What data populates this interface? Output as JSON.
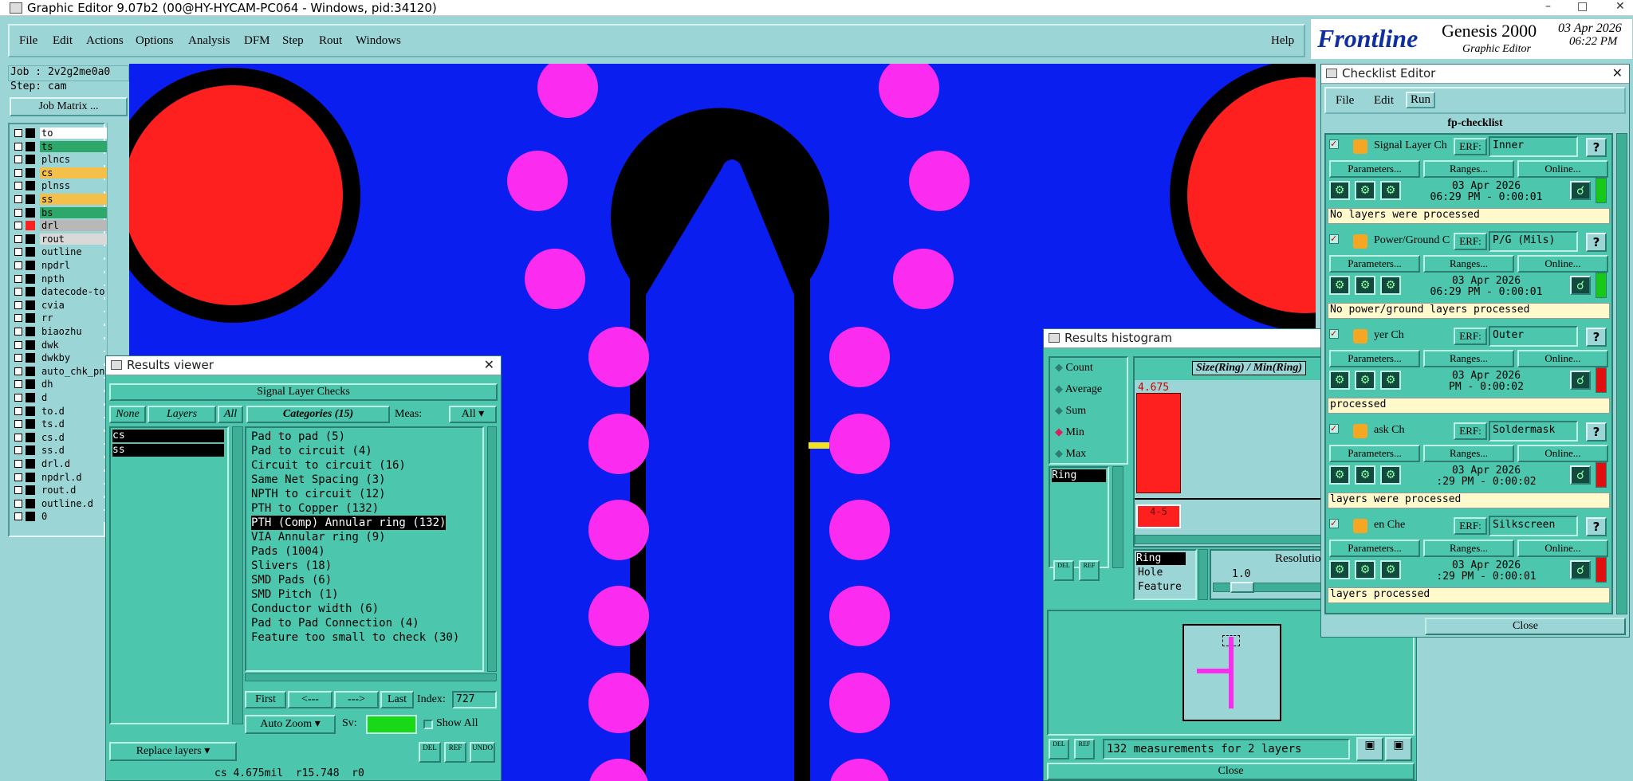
{
  "window": {
    "title": "Graphic Editor 9.07b2 (00@HY-HYCAM-PC064 - Windows, pid:34120)"
  },
  "menu": {
    "items": [
      "File",
      "Edit",
      "Actions",
      "Options",
      "Analysis",
      "DFM",
      "Step",
      "Rout",
      "Windows"
    ],
    "help": "Help"
  },
  "logo": {
    "brand": "Frontline",
    "product": "Genesis 2000",
    "module": "Graphic Editor",
    "date": "03 Apr 2026",
    "time": "06:22 PM"
  },
  "job": {
    "job_label": "Job : 2v2g2me0a0",
    "step_label": "Step: cam",
    "matrix_button": "Job Matrix ..."
  },
  "layers": [
    {
      "name": "to",
      "color": "#ffffff"
    },
    {
      "name": "ts",
      "color": "#2ea86a"
    },
    {
      "name": "plncs",
      "color": "#9bd5d6"
    },
    {
      "name": "cs",
      "color": "#f5c04a"
    },
    {
      "name": "plnss",
      "color": "#9bd5d6"
    },
    {
      "name": "ss",
      "color": "#f5c04a"
    },
    {
      "name": "bs",
      "color": "#2ea86a"
    },
    {
      "name": "drl",
      "color": "#b8b8b8"
    },
    {
      "name": "rout",
      "color": "#d9d9d9"
    },
    {
      "name": "outline",
      "color": "#9bd5d6"
    },
    {
      "name": "npdrl",
      "color": "#9bd5d6"
    },
    {
      "name": "npth",
      "color": "#9bd5d6"
    },
    {
      "name": "datecode-to",
      "color": "#9bd5d6"
    },
    {
      "name": "cvia",
      "color": "#9bd5d6"
    },
    {
      "name": "rr",
      "color": "#9bd5d6"
    },
    {
      "name": "biaozhu",
      "color": "#9bd5d6"
    },
    {
      "name": "dwk",
      "color": "#9bd5d6"
    },
    {
      "name": "dwkby",
      "color": "#9bd5d6"
    },
    {
      "name": "auto_chk_pn",
      "color": "#9bd5d6"
    },
    {
      "name": "dh",
      "color": "#9bd5d6"
    },
    {
      "name": "d",
      "color": "#9bd5d6"
    },
    {
      "name": "to.d",
      "color": "#9bd5d6"
    },
    {
      "name": "ts.d",
      "color": "#9bd5d6"
    },
    {
      "name": "cs.d",
      "color": "#9bd5d6"
    },
    {
      "name": "ss.d",
      "color": "#9bd5d6"
    },
    {
      "name": "drl.d",
      "color": "#9bd5d6"
    },
    {
      "name": "npdrl.d",
      "color": "#9bd5d6"
    },
    {
      "name": "rout.d",
      "color": "#9bd5d6"
    },
    {
      "name": "outline.d",
      "color": "#9bd5d6"
    },
    {
      "name": "0",
      "color": "#9bd5d6"
    }
  ],
  "results_viewer": {
    "title": "Results viewer",
    "header": "Signal Layer Checks",
    "none_btn": "None",
    "layers_btn": "Layers",
    "all_btn": "All",
    "layer_items": [
      "cs",
      "ss"
    ],
    "categories_label": "Categories (15)",
    "meas_label": "Meas:",
    "meas_value": "All",
    "categories": [
      "Pad to pad (5)",
      "Pad to circuit (4)",
      "Circuit to circuit (16)",
      "Same Net Spacing (3)",
      "NPTH to circuit (12)",
      "PTH to Copper (132)",
      "PTH (Comp) Annular ring (132)",
      "VIA Annular ring (9)",
      "Pads (1004)",
      "Slivers (18)",
      "SMD Pads (6)",
      "SMD Pitch (1)",
      "Conductor width (6)",
      "Pad to Pad Connection (4)",
      "Feature too small to check (30)"
    ],
    "first_btn": "First",
    "prev_btn": "<---",
    "next_btn": "--->",
    "last_btn": "Last",
    "index_label": "Index:",
    "index_value": "727",
    "autozoom": "Auto Zoom",
    "sv_label": "Sv:",
    "show_all": "Show All",
    "replace_layers": "Replace layers",
    "del": "DEL",
    "ref": "REF",
    "undo": "UNDO",
    "status": "cs 4.675mil  r15.748  r0"
  },
  "histogram": {
    "title": "Results histogram",
    "radios": [
      "Count",
      "Average",
      "Sum",
      "Min",
      "Max"
    ],
    "selected_radio": "Min",
    "list_item": "Ring",
    "chart_title": "Size(Ring) / Min(Ring)",
    "bar_value": "4.675",
    "bar_label": "4-5",
    "types": [
      "Ring",
      "Hole",
      "Feature"
    ],
    "resolution_label": "Resolution",
    "resolution_value": "1.0",
    "del": "DEL",
    "ref": "REF",
    "measurements": "132 measurements for 2 layers",
    "close": "Close"
  },
  "checklist": {
    "title": "Checklist Editor",
    "menu": [
      "File",
      "Edit",
      "Run"
    ],
    "name": "fp-checklist",
    "erf_label": "ERF:",
    "params": "Parameters...",
    "ranges": "Ranges...",
    "online": "Online...",
    "close": "Close",
    "actions": [
      {
        "label": "Signal Layer Ch",
        "erf": "Inner",
        "date": "03 Apr 2026",
        "time": "06:29 PM - 0:00:01",
        "message": "No layers were processed",
        "status": "#18c818"
      },
      {
        "label": "Power/Ground C",
        "erf": "P/G (Mils)",
        "date": "03 Apr 2026",
        "time": "06:29 PM - 0:00:01",
        "message": "No power/ground layers processed",
        "status": "#18c818"
      },
      {
        "label": "yer Ch",
        "erf": "Outer",
        "date": "03 Apr 2026",
        "time": "PM - 0:00:02",
        "message": "processed",
        "status": "#e01010"
      },
      {
        "label": "ask Ch",
        "erf": "Soldermask",
        "date": "03 Apr 2026",
        "time": ":29 PM - 0:00:02",
        "message": "layers were processed",
        "status": "#e01010"
      },
      {
        "label": "en Che",
        "erf": "Silkscreen",
        "date": "03 Apr 2026",
        "time": ":29 PM - 0:00:01",
        "message": "layers processed",
        "status": "#e01010"
      }
    ]
  }
}
